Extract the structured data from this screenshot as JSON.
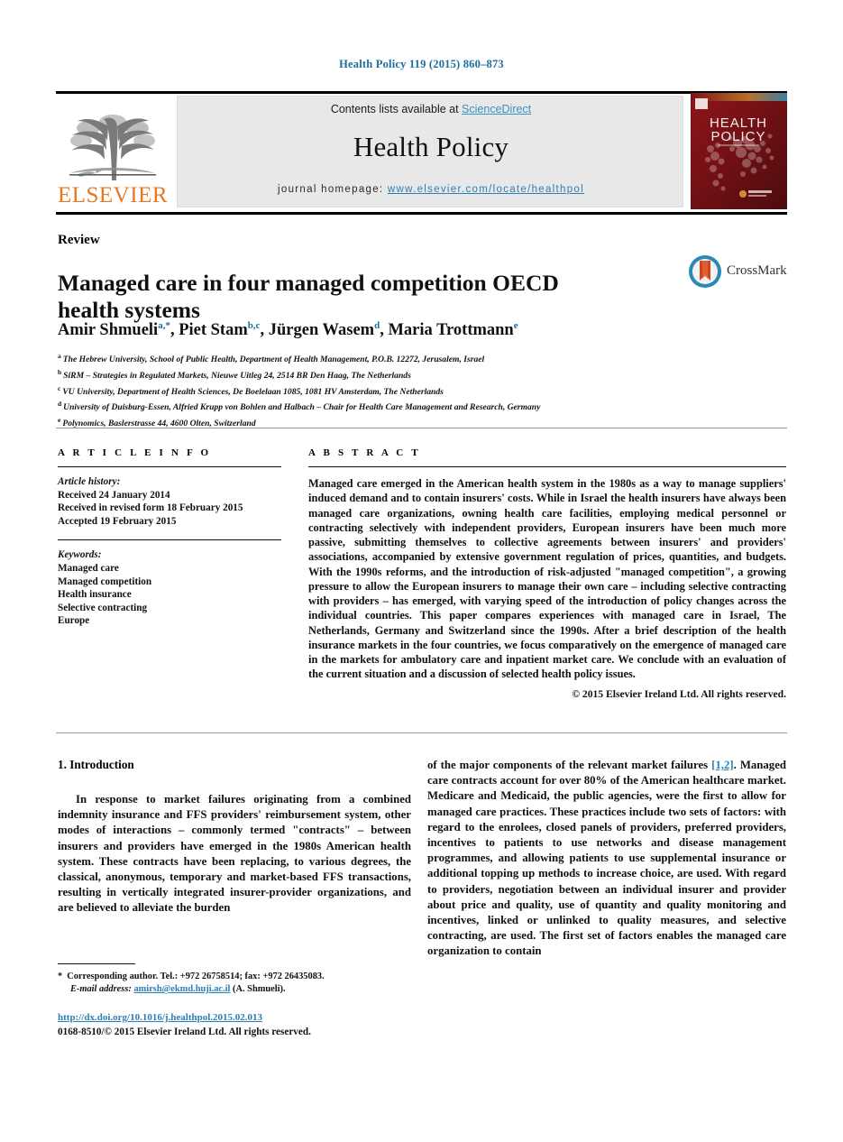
{
  "running_head": "Health Policy 119 (2015) 860–873",
  "masthead": {
    "contents_prefix": "Contents lists available at ",
    "sciencedirect": "ScienceDirect",
    "journal_title": "Health Policy",
    "homepage_prefix": "journal homepage: ",
    "homepage_url": "www.elsevier.com/locate/healthpol",
    "publisher_logo_text": "ELSEVIER",
    "cover_title_line1": "HEALTH",
    "cover_title_line2": "POLICY",
    "colors": {
      "link_blue": "#3a8fc4",
      "running_head_blue": "#1a6e9e",
      "elsevier_orange": "#e87722",
      "cover_red": "#7d1216",
      "band_gray": "#e8e8e8"
    }
  },
  "article": {
    "doctype": "Review",
    "title": "Managed care in four managed competition OECD health systems",
    "crossmark_label": "CrossMark",
    "authors_html": "Amir Shmueli<sup>a,*</sup>, Piet Stam<sup>b,c</sup>, Jürgen Wasem<sup>d</sup>, Maria Trottmann<sup>e</sup>",
    "affiliations": [
      {
        "mark": "a",
        "text": "The Hebrew University, School of Public Health, Department of Health Management, P.O.B. 12272, Jerusalem, Israel"
      },
      {
        "mark": "b",
        "text": "SiRM – Strategies in Regulated Markets, Nieuwe Uitleg 24, 2514 BR Den Haag, The Netherlands"
      },
      {
        "mark": "c",
        "text": "VU University, Department of Health Sciences, De Boelelaan 1085, 1081 HV Amsterdam, The Netherlands"
      },
      {
        "mark": "d",
        "text": "University of Duisburg-Essen, Alfried Krupp von Bohlen and Halbach – Chair for Health Care Management and Research, Germany"
      },
      {
        "mark": "e",
        "text": "Polynomics, Baslerstrasse 44, 4600 Olten, Switzerland"
      }
    ]
  },
  "article_info": {
    "label": "A R T I C L E   I N F O",
    "history_title": "Article history:",
    "history": [
      "Received 24 January 2014",
      "Received in revised form 18 February 2015",
      "Accepted 19 February 2015"
    ],
    "keywords_title": "Keywords:",
    "keywords": [
      "Managed care",
      "Managed competition",
      "Health insurance",
      "Selective contracting",
      "Europe"
    ]
  },
  "abstract": {
    "label": "A B S T R A C T",
    "text": "Managed care emerged in the American health system in the 1980s as a way to manage suppliers' induced demand and to contain insurers' costs. While in Israel the health insurers have always been managed care organizations, owning health care facilities, employing medical personnel or contracting selectively with independent providers, European insurers have been much more passive, submitting themselves to collective agreements between insurers' and providers' associations, accompanied by extensive government regulation of prices, quantities, and budgets. With the 1990s reforms, and the introduction of risk-adjusted \"managed competition\", a growing pressure to allow the European insurers to manage their own care – including selective contracting with providers – has emerged, with varying speed of the introduction of policy changes across the individual countries. This paper compares experiences with managed care in Israel, The Netherlands, Germany and Switzerland since the 1990s. After a brief description of the health insurance markets in the four countries, we focus comparatively on the emergence of managed care in the markets for ambulatory care and inpatient market care. We conclude with an evaluation of the current situation and a discussion of selected health policy issues.",
    "copyright": "© 2015 Elsevier Ireland Ltd. All rights reserved."
  },
  "body": {
    "intro_heading": "1.  Introduction",
    "left_paragraph": "In response to market failures originating from a combined indemnity insurance and FFS providers' reimbursement system, other modes of interactions – commonly termed \"contracts\" – between insurers and providers have emerged in the 1980s American health system. These contracts have been replacing, to various degrees, the classical, anonymous, temporary and market-based FFS transactions, resulting in vertically integrated insurer-provider organizations, and are believed to alleviate the burden",
    "right_paragraph_part1": "of the major components of the relevant market failures ",
    "right_reference": "[1,2]",
    "right_paragraph_part2": ". Managed care contracts account for over 80% of the American healthcare market. Medicare and Medicaid, the public agencies, were the first to allow for managed care practices. These practices include two sets of factors: with regard to the enrolees, closed panels of providers, preferred providers, incentives to patients to use networks and disease management programmes, and allowing patients to use supplemental insurance or additional topping up methods to increase choice, are used. With regard to providers, negotiation between an individual insurer and provider about price and quality, use of quantity and quality monitoring and incentives, linked or unlinked to quality measures, and selective contracting, are used. The first set of factors enables the managed care organization to contain"
  },
  "footer": {
    "star": "*",
    "corresponding": "Corresponding author. Tel.: +972 26758514; fax: +972 26435083.",
    "email_label": "E-mail address:",
    "email": "amirsh@ekmd.huji.ac.il",
    "email_suffix": " (A. Shmueli).",
    "doi": "http://dx.doi.org/10.1016/j.healthpol.2015.02.013",
    "issn": "0168-8510/© 2015 Elsevier Ireland Ltd. All rights reserved."
  }
}
